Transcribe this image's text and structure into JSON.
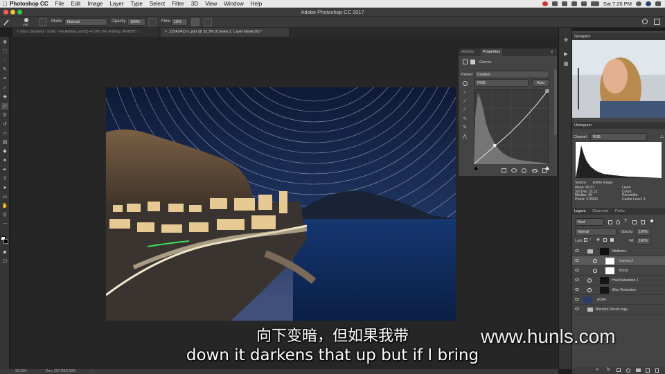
{
  "menubar": {
    "app": "Photoshop CC",
    "items": [
      "File",
      "Edit",
      "Image",
      "Layer",
      "Type",
      "Select",
      "Filter",
      "3D",
      "View",
      "Window",
      "Help"
    ],
    "clock": "Sat 7:26 PM"
  },
  "window": {
    "title": "Adobe Photoshop CC 2017"
  },
  "options": {
    "brush_size": "284",
    "mode_label": "Mode:",
    "mode_value": "Normal",
    "opacity_label": "Opacity:",
    "opacity_value": "100%",
    "flow_label": "Flow:",
    "flow_value": "10%"
  },
  "tabs": [
    {
      "label": "Stars Stacked - Solid - No Editing.psd @ 47.8% (No Editing, RGB/8*) *"
    },
    {
      "label": "_DSF2413-1.psd @ 33.3% (Curves 2, Layer Mask/16) *"
    }
  ],
  "properties": {
    "tab_actions": "Actions",
    "tab_properties": "Properties",
    "panel_title": "Curves",
    "preset_label": "Preset:",
    "preset_value": "Custom",
    "channel_value": "RGB",
    "auto_label": "Auto"
  },
  "navigator": {
    "title": "Navigator"
  },
  "histogram": {
    "title": "Histogram",
    "channel_label": "Channel:",
    "channel_value": "RGB",
    "source_label": "Source:",
    "source_value": "Entire Image",
    "stats_left": [
      "Mean: 49.37",
      "Std Dev: 31.11",
      "Median: 40",
      "Pixels: 375000"
    ],
    "stats_right": [
      "Level:",
      "Count:",
      "Percentile:",
      "Cache Level: 4"
    ]
  },
  "layers": {
    "tabs": [
      "Layers",
      "Channels",
      "Paths"
    ],
    "kind_label": "Kind",
    "blend_value": "Normal",
    "opacity_label": "Opacity:",
    "opacity_value": "100%",
    "lock_label": "Lock:",
    "fill_label": "Fill:",
    "fill_value": "100%",
    "items": [
      {
        "name": "Midtones"
      },
      {
        "name": "Curves 2"
      },
      {
        "name": "Boost"
      },
      {
        "name": "Hue/Saturation 1"
      },
      {
        "name": "Blue Reduction"
      },
      {
        "name": "ACRF"
      },
      {
        "name": "Blended Result copy"
      }
    ]
  },
  "status": {
    "zoom": "33.33%",
    "doc": "Doc: 257.3M/2.02G"
  },
  "subtitles": {
    "chinese": "向下变暗，但如果我带",
    "english": "down it darkens that up but if I bring"
  },
  "watermark": "www.hunls.com",
  "colors": {
    "panel": "#444444",
    "toolbar": "#353535",
    "canvas": "#262626",
    "accent": "#1e6fd9"
  }
}
